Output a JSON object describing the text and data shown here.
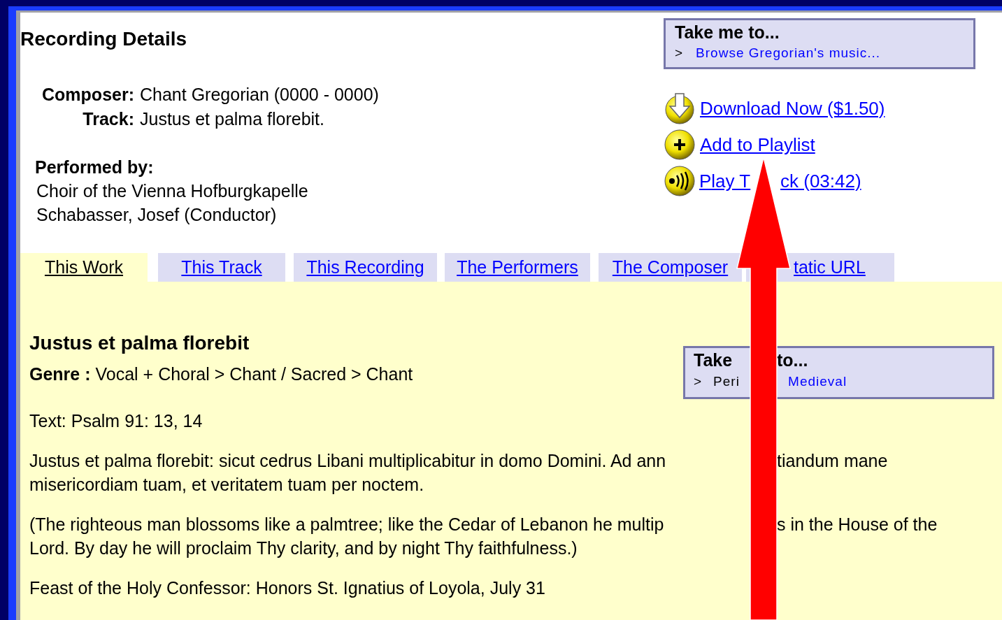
{
  "page_title": "Recording Details",
  "details": [
    {
      "label": "Composer:",
      "value": "Chant Gregorian (0000 - 0000)"
    },
    {
      "label": "Track:",
      "value": "Justus et palma florebit."
    }
  ],
  "performed_by": {
    "label": "Performed by:",
    "names": [
      "Choir of the Vienna Hofburgkapelle",
      "Schabasser, Josef (Conductor)"
    ]
  },
  "take_me_to": {
    "title": "Take me to...",
    "marker": ">",
    "link": "Browse Gregorian's music..."
  },
  "actions": [
    {
      "kind": "download",
      "parts": [
        "Download Now ($1.50)"
      ]
    },
    {
      "kind": "playlist",
      "parts": [
        "Add to Playlist"
      ]
    },
    {
      "kind": "play",
      "parts": [
        "Play T",
        "ck (03:42)"
      ]
    }
  ],
  "tabs": [
    {
      "label": "This Work",
      "selected": true
    },
    {
      "label": "This Track",
      "selected": false
    },
    {
      "label": "This Recording",
      "selected": false
    },
    {
      "label": "The Performers",
      "selected": false
    },
    {
      "label": "The Composer",
      "selected": false
    },
    {
      "label": "tatic URL",
      "selected": false
    }
  ],
  "work": {
    "title": "Justus et palma florebit",
    "genre_label": "Genre :",
    "genre": "Vocal + Choral > Chant / Sacred > Chant",
    "take_me_to": {
      "title_parts": [
        "Take",
        "to..."
      ],
      "marker": ">",
      "label": "Peri",
      "link": "Medieval"
    },
    "paragraphs": [
      [
        [
          "Text: Psalm 91: 13, 14"
        ]
      ],
      [
        [
          "Justus et palma florebit: sicut cedrus Libani multiplicabitur in domo Domini. Ad ann",
          "tiandum mane"
        ],
        [
          "misericordiam tuam, et veritatem tuam per noctem."
        ]
      ],
      [
        [
          "(The righteous man blossoms like a palmtree; like the Cedar of Lebanon he multip",
          "s in the House of the"
        ],
        [
          "Lord. By day he will proclaim Thy clarity, and by night Thy faithfulness.)"
        ]
      ],
      [
        [
          "Feast of the Holy Confessor: Honors St. Ignatius of Loyola, July 31"
        ]
      ]
    ]
  }
}
